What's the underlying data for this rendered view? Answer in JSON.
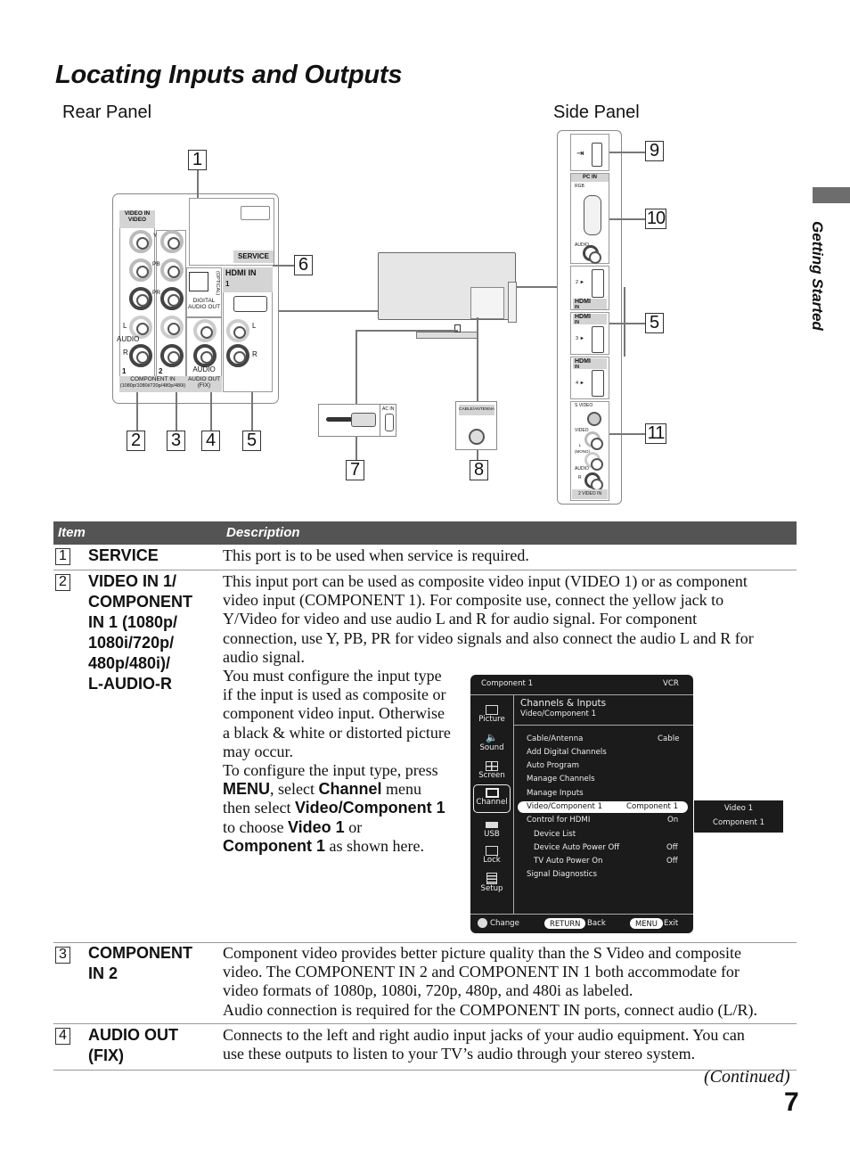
{
  "page": {
    "title": "Locating Inputs and Outputs",
    "section_tab": "Getting Started",
    "continued": "(Continued)",
    "page_number": "7"
  },
  "diagram": {
    "rear_panel_label": "Rear Panel",
    "side_panel_label": "Side Panel",
    "callouts": [
      "1",
      "2",
      "3",
      "4",
      "5",
      "6",
      "7",
      "8",
      "9",
      "10",
      "11",
      "5"
    ],
    "rear_labels": {
      "video_in": "VIDEO IN",
      "video": "VIDEO",
      "y": "Y",
      "pb": "PB",
      "pr": "PR",
      "l": "L",
      "audio": "AUDIO",
      "r": "R",
      "one": "1",
      "two": "2",
      "component_in": "COMPONENT IN",
      "component_formats": "(1080p/1080i/720p/480p/480i)",
      "service": "SERVICE",
      "optical": "(OPTICAL)",
      "digital_audio_out": "DIGITAL AUDIO OUT",
      "hdmi_in": "HDMI IN",
      "hdmi_num": "1",
      "audio_out_label": "AUDIO",
      "audio_out": "AUDIO OUT",
      "fix": "(FIX)"
    },
    "tv_labels": {
      "ac_in": "AC IN",
      "cable_antenna": "CABLE/ANTENNA"
    },
    "side_labels": {
      "pc_in": "PC IN",
      "rgb": "RGB",
      "audio": "AUDIO",
      "hdmi": "HDMI",
      "in": "IN",
      "hdmi2": "2 ►",
      "hdmi3": "3 ►",
      "hdmi4": "4 ►",
      "s_video": "S VIDEO",
      "video": "VIDEO",
      "l_mono": "L (MONO)",
      "audio2": "AUDIO",
      "r": "R",
      "video_in_2": "2 VIDEO IN"
    }
  },
  "table": {
    "headers": {
      "item": "Item",
      "description": "Description"
    },
    "rows": [
      {
        "num": "1",
        "title": "SERVICE",
        "description": "This port is to be used when service is required."
      },
      {
        "num": "2",
        "title_lines": [
          "VIDEO IN 1/",
          "COMPONENT",
          "IN 1 (1080p/",
          "1080i/720p/",
          "480p/480i)/",
          "L-AUDIO-R"
        ],
        "description_lines": [
          "This input port can be used as composite video input (VIDEO 1) or as component",
          "video input (COMPONENT 1). For composite use, connect the yellow jack to",
          "Y/Video for video and use audio L and R for audio signal. For component",
          "connection, use Y, PB, PR for video signals and also connect the audio L and R for",
          "audio signal."
        ],
        "config_lines": [
          "You must configure the input type",
          "if the input is used as composite or",
          "component video input. Otherwise",
          "a black & white or distorted picture",
          "may occur.",
          "To configure the input type, press"
        ],
        "instr": {
          "menu": "MENU",
          "t1": ", select ",
          "channel": "Channel",
          "t2": " menu",
          "t3": "then select ",
          "video_component": "Video/Component 1",
          "t4": "to choose ",
          "video1": "Video 1",
          "t5": " or",
          "component1": "Component 1",
          "t6": " as shown here."
        }
      },
      {
        "num": "3",
        "title_lines": [
          "COMPONENT",
          "IN 2"
        ],
        "description_lines": [
          "Component video provides better picture quality than the S Video and composite",
          "video. The COMPONENT IN 2 and COMPONENT IN 1 both accommodate for",
          "video formats of 1080p, 1080i, 720p, 480p, and 480i as labeled.",
          "Audio connection is required for the COMPONENT IN ports, connect audio (L/R)."
        ]
      },
      {
        "num": "4",
        "title_lines": [
          "AUDIO OUT",
          "(FIX)"
        ],
        "description_lines": [
          "Connects to the left and right audio input jacks of your audio equipment. You can",
          "use these outputs to listen to your TV’s audio through your stereo system."
        ]
      }
    ]
  },
  "osd": {
    "input": "Component 1",
    "source": "VCR",
    "menu_title": "Channels & Inputs",
    "menu_subtitle": "Video/Component 1",
    "sidebar": [
      {
        "label": "Picture",
        "icon": "picture-icon"
      },
      {
        "label": "Sound",
        "icon": "speaker-icon"
      },
      {
        "label": "Screen",
        "icon": "screen-icon"
      },
      {
        "label": "Channel",
        "icon": "channel-icon",
        "selected": true
      },
      {
        "label": "USB",
        "icon": "usb-icon"
      },
      {
        "label": "Lock",
        "icon": "lock-icon"
      },
      {
        "label": "Setup",
        "icon": "setup-icon"
      }
    ],
    "items": [
      {
        "label": "Cable/Antenna",
        "value": "Cable"
      },
      {
        "label": "Add Digital Channels",
        "value": ""
      },
      {
        "label": "Auto Program",
        "value": ""
      },
      {
        "label": "Manage Channels",
        "value": ""
      },
      {
        "label": "Manage Inputs",
        "value": ""
      },
      {
        "label": "Video/Component 1",
        "value": "Component 1",
        "selected": true
      },
      {
        "label": "Control for HDMI",
        "value": "On"
      },
      {
        "label": "Device List",
        "value": "",
        "indent": true
      },
      {
        "label": "Device Auto Power Off",
        "value": "Off",
        "indent": true
      },
      {
        "label": "TV Auto Power On",
        "value": "Off",
        "indent": true
      },
      {
        "label": "Signal Diagnostics",
        "value": ""
      }
    ],
    "submenu": [
      "Video 1",
      "Component 1"
    ],
    "footer": {
      "change": "Change",
      "return_key": "RETURN",
      "back": "Back",
      "menu_key": "MENU",
      "exit": "Exit"
    }
  }
}
